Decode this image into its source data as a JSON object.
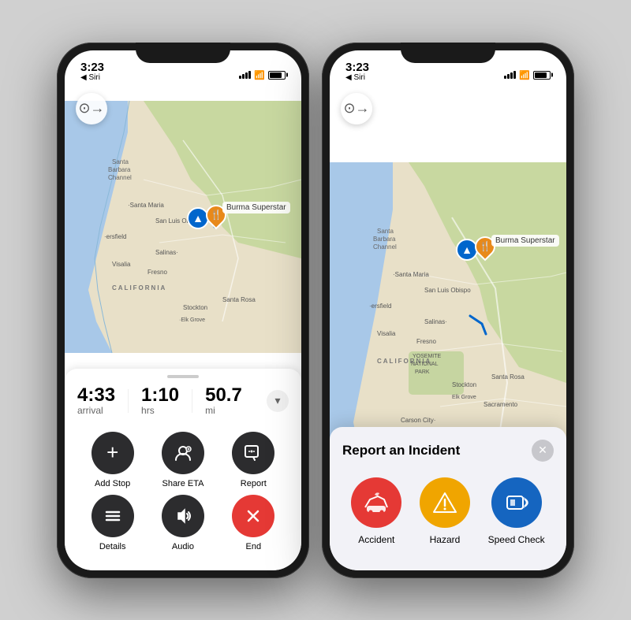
{
  "colors": {
    "accent_blue": "#0066cc",
    "accent_orange": "#E8891A",
    "dark_button": "#2c2c2e",
    "red_button": "#e53935",
    "accident_red": "#e53935",
    "hazard_yellow": "#f0a500",
    "speed_blue": "#1565c0"
  },
  "phone1": {
    "status": {
      "time": "3:23",
      "time_arrow": "▲",
      "siri_label": "◀ Siri"
    },
    "back_button_icon": "⊙→",
    "nav_info": {
      "arrival_time": "4:33",
      "arrival_label": "arrival",
      "hrs": "1:10",
      "hrs_label": "hrs",
      "miles": "50.7",
      "miles_label": "mi"
    },
    "action_rows": [
      [
        {
          "icon": "+",
          "label": "Add Stop"
        },
        {
          "icon": "👤+",
          "label": "Share ETA"
        },
        {
          "icon": "💬",
          "label": "Report"
        }
      ],
      [
        {
          "icon": "≡",
          "label": "Details"
        },
        {
          "icon": "🔊",
          "label": "Audio"
        },
        {
          "icon": "✕",
          "label": "End",
          "style": "red"
        }
      ]
    ],
    "destination": "Burma Superstar"
  },
  "phone2": {
    "status": {
      "time": "3:23",
      "time_arrow": "▲",
      "siri_label": "◀ Siri"
    },
    "back_button_icon": "⊙→",
    "destination": "Burma Superstar",
    "report_panel": {
      "title": "Report an Incident",
      "close_icon": "✕",
      "buttons": [
        {
          "icon": "🚗💥",
          "label": "Accident",
          "style": "accident"
        },
        {
          "icon": "⚠",
          "label": "Hazard",
          "style": "hazard"
        },
        {
          "icon": "📷",
          "label": "Speed Check",
          "style": "speed"
        }
      ]
    }
  }
}
